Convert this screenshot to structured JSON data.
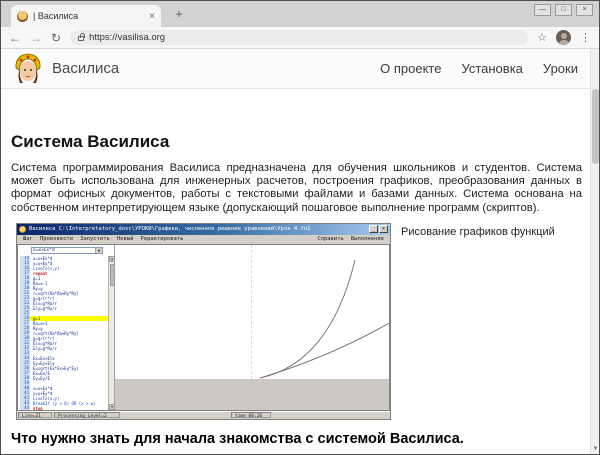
{
  "browser": {
    "tab": {
      "title": "| Василиса",
      "close_glyph": "×",
      "new_tab_glyph": "+"
    },
    "window_controls": {
      "minimize": "—",
      "maximize": "□",
      "close": "×"
    },
    "toolbar": {
      "back_glyph": "←",
      "forward_glyph": "→",
      "reload_glyph": "↻",
      "url": "https://vasilisa.org",
      "bookmark_glyph": "☆",
      "menu_glyph": "⋮"
    },
    "scrollbar_down_glyph": "▼"
  },
  "site": {
    "header": {
      "brand": "Василиса",
      "nav": [
        "О проекте",
        "Установка",
        "Уроки"
      ]
    },
    "main": {
      "title": "Система Василиса",
      "intro": "Система программирования Василиса предназначена для обучения школьников и студентов. Система может быть использована для инженерных расчетов, построения графиков, преобразования данных в формат офисных документов, работы с текстовыми файлами и базами данных. Система основана на собственном интерпретирующем языке (допускающий пошаговое выполнение программ (скриптов).",
      "figure_caption": "Рисование графиков функций",
      "footer_title": "Что нужно знать для начала знакомства с системой Василиса."
    }
  },
  "ide": {
    "title": "Василиса  C:\\Interpretatory_dosc\\УРОКИ\\Графики, численное решение уравнений\\Урок 4.fn1",
    "window_buttons": {
      "minimize": "_",
      "close": "×"
    },
    "menu_left": [
      "Шаг",
      "Произвести",
      "Запустить",
      "Новый",
      "Редактировать"
    ],
    "menu_right": [
      "Справить",
      "Выполнение"
    ],
    "combo_value": "x=x+Ex*d",
    "combo_arrow": "▼",
    "code": [
      {
        "n": "14",
        "t": "x=x+Ex*d",
        "c": ""
      },
      {
        "n": "15",
        "t": "y=y+Ey*d",
        "c": ""
      },
      {
        "n": "16",
        "t": "LineTo(x,y)",
        "c": "f"
      },
      {
        "n": "17",
        "t": "repeat",
        "c": "k"
      },
      {
        "n": "18",
        "t": "  g=1",
        "c": ""
      },
      {
        "n": "19",
        "t": "  Ra=x-1",
        "c": ""
      },
      {
        "n": "20",
        "t": "  Ry=y",
        "c": ""
      },
      {
        "n": "21",
        "t": "  r=sqrt(Ra*Ra+Ry*Ry)",
        "c": ""
      },
      {
        "n": "22",
        "t": "  g=g/(r*r)",
        "c": ""
      },
      {
        "n": "23",
        "t": "  Elx=g*Ra/r",
        "c": ""
      },
      {
        "n": "24",
        "t": "  Ely=g*Ry/r",
        "c": ""
      },
      {
        "n": "25",
        "t": "",
        "c": ""
      },
      {
        "n": "26",
        "t": "  g=1",
        "c": "",
        "hl": true
      },
      {
        "n": "27",
        "t": "  Ra=x+1",
        "c": ""
      },
      {
        "n": "28",
        "t": "  Ry=y",
        "c": ""
      },
      {
        "n": "29",
        "t": "  r=sqrt(Ra*Ra+Ry*Ry)",
        "c": ""
      },
      {
        "n": "30",
        "t": "  g=g/(r*r)",
        "c": ""
      },
      {
        "n": "31",
        "t": "  Elx=g*Ra/r",
        "c": ""
      },
      {
        "n": "32",
        "t": "  Ely=g*Ry/r",
        "c": ""
      },
      {
        "n": "33",
        "t": "",
        "c": ""
      },
      {
        "n": "34",
        "t": "  Ex=Ex+Elx",
        "c": ""
      },
      {
        "n": "35",
        "t": "  Ey=Ey+Ely",
        "c": ""
      },
      {
        "n": "36",
        "t": "  E=sqrt(Ex*Ex+Ey*Ey)",
        "c": ""
      },
      {
        "n": "37",
        "t": "  Ex=Ex/E",
        "c": ""
      },
      {
        "n": "38",
        "t": "  Ey=Ey/E",
        "c": ""
      },
      {
        "n": "39",
        "t": "",
        "c": ""
      },
      {
        "n": "40",
        "t": "  x=x+Ex*d",
        "c": ""
      },
      {
        "n": "41",
        "t": "  y=y+Ey*d",
        "c": ""
      },
      {
        "n": "42",
        "t": "  LineTo(x,y)",
        "c": "f"
      },
      {
        "n": "43",
        "t": "  BreakIf (y < 0) OR (x > w)",
        "c": "f"
      },
      {
        "n": "44",
        "t": "stop",
        "c": "k"
      }
    ],
    "status": [
      "Line=21",
      "Processing Level=2",
      "time 00:26"
    ],
    "graph": {
      "description": "two rising curves from a common origin at bottom center",
      "curve_color": "#707070"
    }
  }
}
